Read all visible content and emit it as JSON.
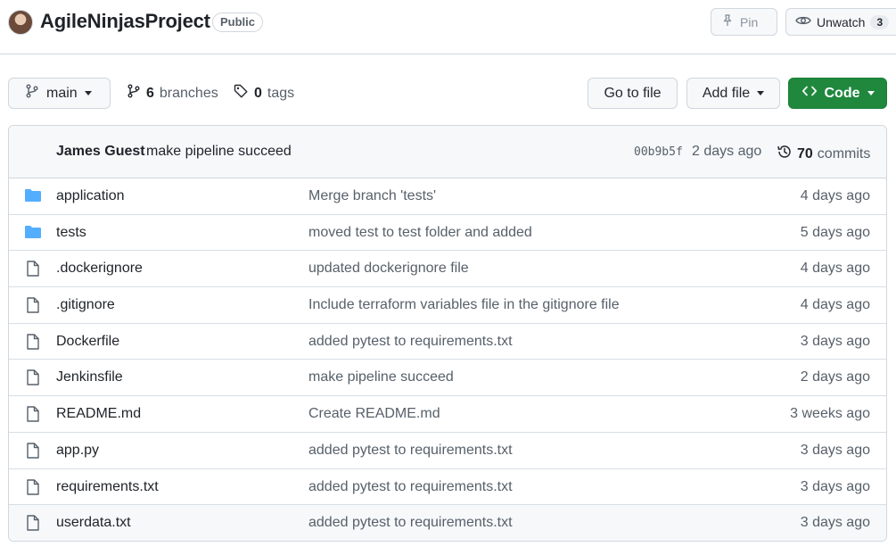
{
  "repo": {
    "name": "AgileNinjasProject",
    "visibility": "Public",
    "pin_label": "Pin",
    "watch_label": "Unwatch",
    "watch_count": "3"
  },
  "toolbar": {
    "branch": "main",
    "branches_count": "6",
    "branches_label": "branches",
    "tags_count": "0",
    "tags_label": "tags",
    "goto_file": "Go to file",
    "add_file": "Add file",
    "code": "Code"
  },
  "latest_commit": {
    "author": "James Guest",
    "message": "make pipeline succeed",
    "sha": "00b9b5f",
    "time": "2 days ago",
    "count": "70",
    "count_label": "commits"
  },
  "colors": {
    "accent_green": "#1f883d",
    "folder_blue": "#54aeff"
  },
  "files": [
    {
      "name": "application",
      "type": "folder-icon",
      "message": "Merge branch 'tests'",
      "time": "4 days ago"
    },
    {
      "name": "tests",
      "type": "folder-icon",
      "message": "moved test to test folder and added",
      "time": "5 days ago"
    },
    {
      "name": ".dockerignore",
      "type": "file-icon",
      "message": "updated dockerignore file",
      "time": "4 days ago"
    },
    {
      "name": ".gitignore",
      "type": "file-icon",
      "message": "Include terraform variables file in the gitignore file",
      "time": "4 days ago"
    },
    {
      "name": "Dockerfile",
      "type": "file-icon",
      "message": "added pytest to requirements.txt",
      "time": "3 days ago"
    },
    {
      "name": "Jenkinsfile",
      "type": "file-icon",
      "message": "make pipeline succeed",
      "time": "2 days ago"
    },
    {
      "name": "README.md",
      "type": "file-icon",
      "message": "Create README.md",
      "time": "3 weeks ago"
    },
    {
      "name": "app.py",
      "type": "file-icon",
      "message": "added pytest to requirements.txt",
      "time": "3 days ago"
    },
    {
      "name": "requirements.txt",
      "type": "file-icon",
      "message": "added pytest to requirements.txt",
      "time": "3 days ago"
    },
    {
      "name": "userdata.txt",
      "type": "file-icon",
      "message": "added pytest to requirements.txt",
      "time": "3 days ago"
    }
  ]
}
